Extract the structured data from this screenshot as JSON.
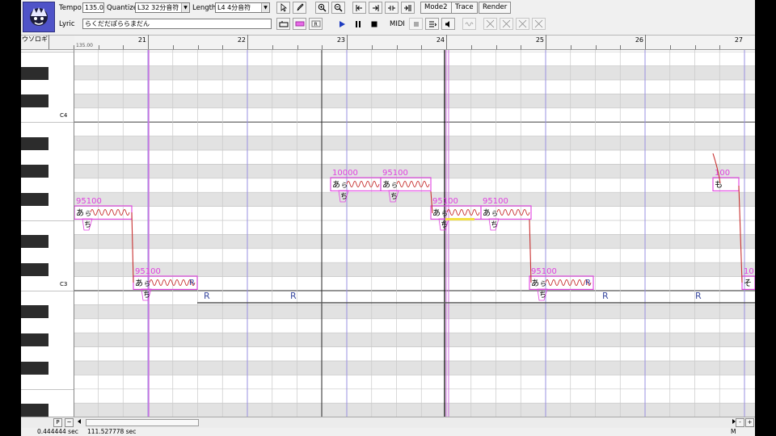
{
  "toolbar": {
    "tempo_label": "Tempo",
    "tempo_value": "135.0",
    "quantize_label": "Quantize",
    "quantize_value": "L32 32分音符",
    "length_label": "Length",
    "length_value": "L4  4分音符",
    "lyric_label": "Lyric",
    "lyric_value": "らくだだぽららまだん",
    "midi_label": "MIDI",
    "mode2_label": "Mode2",
    "trace_label": "Trace",
    "render_label": "Render"
  },
  "track": {
    "name": "ウソロギ",
    "tempo_mark": "135.00"
  },
  "ruler": {
    "measures": [
      "21",
      "22",
      "23",
      "24",
      "25",
      "26",
      "27"
    ]
  },
  "piano": {
    "labels": [
      "C4",
      "C3"
    ]
  },
  "notes": [
    {
      "lyric": "あ",
      "sub": "ら",
      "sub2": "ち",
      "params": "95100",
      "rest": "",
      "rest2": ""
    },
    {
      "lyric": "あ",
      "sub": "ら",
      "sub2": "ち",
      "params": "95100",
      "rest": "R",
      "rest2": "R"
    },
    {
      "lyric": "あ",
      "sub": "ら",
      "sub2": "ち",
      "params": "10000",
      "rest": "",
      "rest2": "R"
    },
    {
      "lyric": "あ",
      "sub": "ら",
      "sub2": "ち",
      "params": "95100",
      "rest": "",
      "rest2": ""
    },
    {
      "lyric": "あ",
      "sub": "ら",
      "sub2": "ち",
      "params": "95100",
      "rest": "",
      "rest2": ""
    },
    {
      "lyric": "あ",
      "sub": "ら",
      "sub2": "ち",
      "params": "95100",
      "rest": "",
      "rest2": ""
    },
    {
      "lyric": "あ",
      "sub": "ら",
      "sub2": "ち",
      "params": "95100",
      "rest": "R",
      "rest2": "R"
    },
    {
      "lyric": "も",
      "sub": "",
      "sub2": "",
      "params": "100",
      "rest": "",
      "rest2": "R"
    },
    {
      "lyric": "そ",
      "sub": "",
      "sub2": "",
      "params": "10",
      "rest": "",
      "rest2": ""
    }
  ],
  "bottom": {
    "p_label": "P",
    "tilde_label": "~",
    "minus_label": "-",
    "plus_label": "+",
    "m_label": "M"
  },
  "status": {
    "time_left": "0.444444 sec",
    "time_right": "111.527778 sec"
  },
  "colors": {
    "note_pink": "#e040e0",
    "pitch_red": "#c83030",
    "rest_blue": "#3a4aa0",
    "playhead": "#d070e0",
    "gridline_purple": "#9a90e0",
    "highlight_yellow": "#f4e040"
  }
}
